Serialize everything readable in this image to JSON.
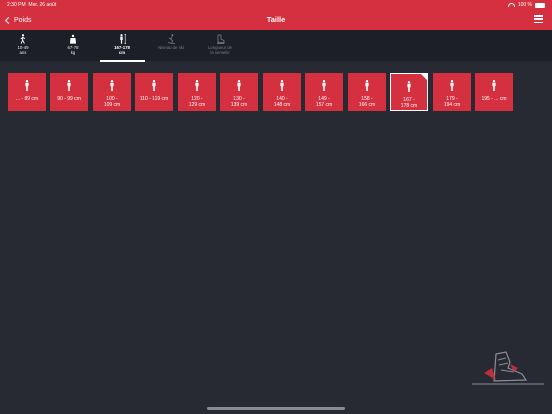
{
  "status": {
    "time": "2:30 PM",
    "date": "Mer. 26 août",
    "battery": "100 %"
  },
  "nav": {
    "back_label": "Poids",
    "title": "Taille"
  },
  "tabs": [
    {
      "label": "10-49\nans"
    },
    {
      "label": "67-78\nkg"
    },
    {
      "label": "167-178\ncm"
    },
    {
      "label": "Niveau de ski"
    },
    {
      "label": "Longueur de\nla semelle"
    }
  ],
  "tiles": [
    {
      "label": "... - 89 cm"
    },
    {
      "label": "90 - 99 cm"
    },
    {
      "label": "100 -\n109 cm"
    },
    {
      "label": "110 - 119 cm"
    },
    {
      "label": "120 -\n129 cm"
    },
    {
      "label": "130 -\n139 cm"
    },
    {
      "label": "140 -\n148 cm"
    },
    {
      "label": "149 -\n157 cm"
    },
    {
      "label": "158 -\n166 cm"
    },
    {
      "label": "167 -\n178 cm"
    },
    {
      "label": "179 -\n194 cm"
    },
    {
      "label": "195 - ... cm"
    }
  ],
  "selected_tile_index": 9,
  "colors": {
    "accent": "#d4303f",
    "background": "#272a33",
    "tabbar": "#1d1f26"
  },
  "icons": {
    "tab_0": "walking-person-icon",
    "tab_1": "weight-icon",
    "tab_2": "height-person-icon",
    "tab_3": "skier-icon",
    "tab_4": "ski-boot-sole-icon",
    "tile": "person-icon",
    "bottom": "ski-boot-icon"
  }
}
